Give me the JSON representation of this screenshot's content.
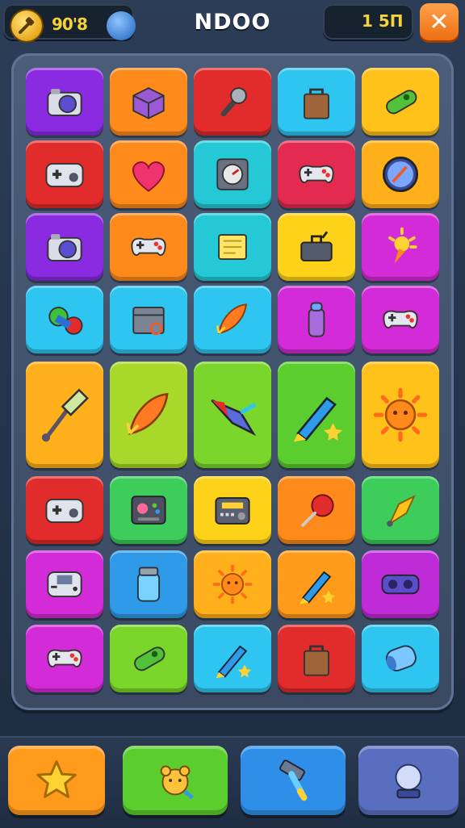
{
  "hud": {
    "coins": "90'8",
    "title": "NDOO",
    "score": "1 5П",
    "close_symbol": "✕",
    "coin_icon": "coin-hammer-icon",
    "gem_icon": "blue-orb-icon"
  },
  "colors": {
    "purple": "#8a2be2",
    "orange": "#ff8a1c",
    "red": "#e22b2b",
    "cyan": "#2ec5f0",
    "yellow": "#ffc21a",
    "teal": "#25c9d6",
    "green": "#5ccd2e",
    "magenta": "#d32bd8",
    "blue": "#2f9be8",
    "lime": "#8fd92a"
  },
  "board": {
    "rows": [
      [
        {
          "color": "#8a2be2",
          "icon": "camera-icon"
        },
        {
          "color": "#ff8a1c",
          "icon": "cube-icon"
        },
        {
          "color": "#e22b2b",
          "icon": "microphone-icon"
        },
        {
          "color": "#2ec5f0",
          "icon": "bag-icon"
        },
        {
          "color": "#ffc21a",
          "icon": "capsule-icon"
        }
      ],
      [
        {
          "color": "#e22b2b",
          "icon": "gamepad-icon"
        },
        {
          "color": "#ff8a1c",
          "icon": "heart-icon"
        },
        {
          "color": "#25c9d6",
          "icon": "gauge-icon"
        },
        {
          "color": "#e22b4f",
          "icon": "controller-icon"
        },
        {
          "color": "#ffb01a",
          "icon": "compass-icon"
        }
      ],
      [
        {
          "color": "#8a2be2",
          "icon": "camera-icon"
        },
        {
          "color": "#ff8a1c",
          "icon": "controller-icon"
        },
        {
          "color": "#25c9d6",
          "icon": "note-icon"
        },
        {
          "color": "#ffd21a",
          "icon": "toolbox-icon"
        },
        {
          "color": "#d32bd8",
          "icon": "spark-icon"
        }
      ],
      [
        {
          "color": "#2ec5f0",
          "icon": "lamp-icon"
        },
        {
          "color": "#2ec5f0",
          "icon": "crate-icon"
        },
        {
          "color": "#2ec5f0",
          "icon": "rocket-icon"
        },
        {
          "color": "#d32bd8",
          "icon": "bottle-icon"
        },
        {
          "color": "#d32bd8",
          "icon": "controller-icon"
        }
      ],
      [
        {
          "color": "#ffb01a",
          "icon": "paintbrush-icon"
        },
        {
          "color": "#a8d82a",
          "icon": "rocket-icon"
        },
        {
          "color": "#7ad62a",
          "icon": "spaceship-icon"
        },
        {
          "color": "#5ccd2e",
          "icon": "crayon-icon"
        },
        {
          "color": "#ffc21a",
          "icon": "sun-icon"
        }
      ],
      [
        {
          "color": "#e22b2b",
          "icon": "gamepad-icon"
        },
        {
          "color": "#3ccd5a",
          "icon": "panel-icon"
        },
        {
          "color": "#ffd21a",
          "icon": "radio-icon"
        },
        {
          "color": "#ff8a1c",
          "icon": "pushpin-icon"
        },
        {
          "color": "#3ccd5a",
          "icon": "carrot-icon"
        }
      ],
      [
        {
          "color": "#d32bd8",
          "icon": "handheld-icon"
        },
        {
          "color": "#2f9be8",
          "icon": "jar-icon"
        },
        {
          "color": "#ffb01a",
          "icon": "sun-icon"
        },
        {
          "color": "#ff9a1a",
          "icon": "crayon-icon"
        },
        {
          "color": "#c02bd8",
          "icon": "vr-icon"
        }
      ],
      [
        {
          "color": "#d32bd8",
          "icon": "controller-icon"
        },
        {
          "color": "#7ad62a",
          "icon": "capsule-icon"
        },
        {
          "color": "#2ec5f0",
          "icon": "crayon-icon"
        },
        {
          "color": "#e22b2b",
          "icon": "bag-icon"
        },
        {
          "color": "#2ec5f0",
          "icon": "can-icon"
        }
      ]
    ]
  },
  "powerups": [
    {
      "color": "#ff9a1c",
      "icon": "star-icon"
    },
    {
      "color": "#5ccd2e",
      "icon": "bear-icon"
    },
    {
      "color": "#2f8fe8",
      "icon": "hammer-icon"
    },
    {
      "color": "#5a6ec0",
      "icon": "globe-icon"
    }
  ]
}
